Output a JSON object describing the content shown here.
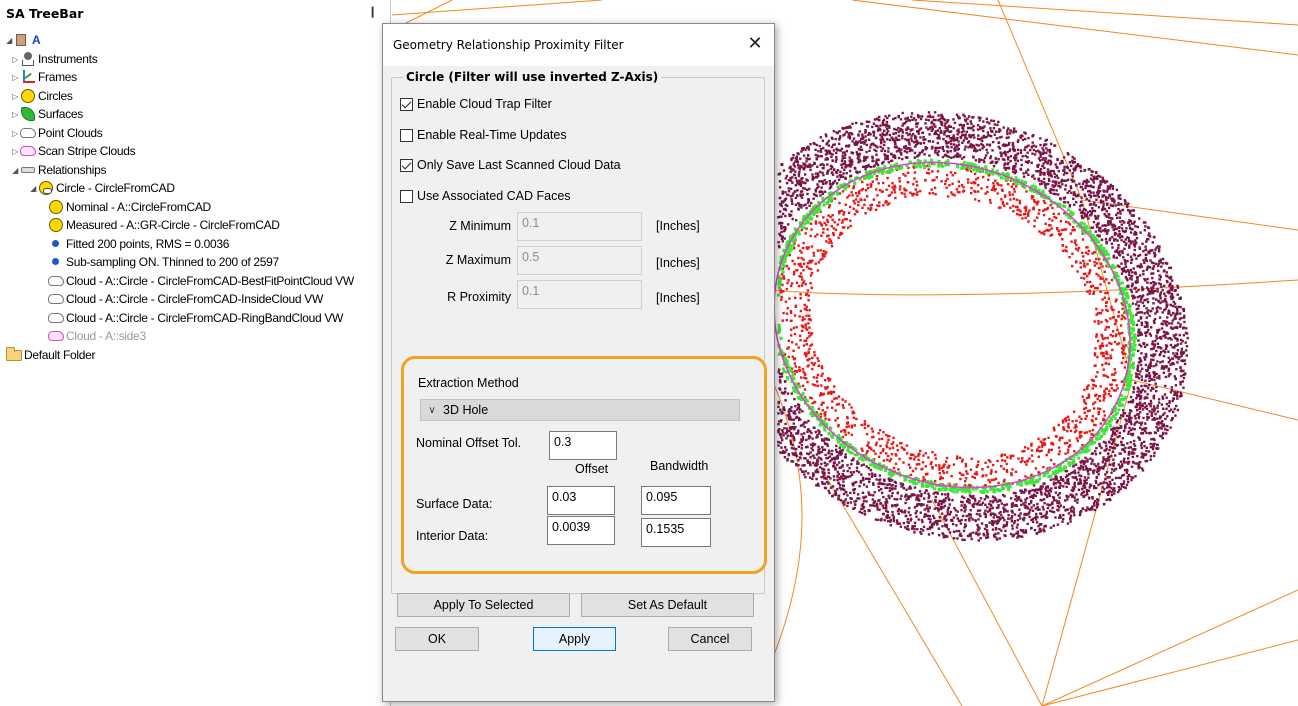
{
  "treebar": {
    "title": "SA TreeBar",
    "pin": "❙",
    "items": [
      {
        "label": "A",
        "icon": "model-icon"
      },
      {
        "label": "Instruments",
        "icon": "instrument-icon"
      },
      {
        "label": "Frames",
        "icon": "frame-icon"
      },
      {
        "label": "Circles",
        "icon": "circle-icon"
      },
      {
        "label": "Surfaces",
        "icon": "surface-icon"
      },
      {
        "label": "Point Clouds",
        "icon": "cloud-icon"
      },
      {
        "label": "Scan Stripe Clouds",
        "icon": "scan-cloud-icon"
      },
      {
        "label": "Relationships",
        "icon": "relationship-icon"
      },
      {
        "label": "Circle - CircleFromCAD",
        "icon": "circle-relationship-icon"
      },
      {
        "label": "Nominal - A::CircleFromCAD",
        "icon": "circle-icon"
      },
      {
        "label": "Measured - A::GR-Circle - CircleFromCAD",
        "icon": "circle-icon"
      },
      {
        "label": "Fitted 200 points, RMS = 0.0036",
        "icon": "info-dot-icon"
      },
      {
        "label": "Sub-sampling ON. Thinned to 200 of 2597",
        "icon": "info-dot-icon"
      },
      {
        "label": "Cloud - A::Circle - CircleFromCAD-BestFitPointCloud VW",
        "icon": "cloud-icon"
      },
      {
        "label": "Cloud - A::Circle - CircleFromCAD-InsideCloud VW",
        "icon": "cloud-icon"
      },
      {
        "label": "Cloud - A::Circle - CircleFromCAD-RingBandCloud VW",
        "icon": "cloud-icon"
      },
      {
        "label": "Cloud - A::side3",
        "icon": "scan-cloud-icon"
      },
      {
        "label": "Default Folder",
        "icon": "folder-icon"
      }
    ]
  },
  "dialog": {
    "title": "Geometry Relationship Proximity Filter",
    "close": "✕",
    "group_title": "Circle (Filter will use inverted Z-Axis)",
    "checks": [
      {
        "label": "Enable Cloud Trap Filter",
        "checked": true
      },
      {
        "label": "Enable Real-Time Updates",
        "checked": false
      },
      {
        "label": "Only Save Last Scanned Cloud Data",
        "checked": true
      },
      {
        "label": "Use Associated CAD Faces",
        "checked": false
      }
    ],
    "z_min": {
      "label": "Z Minimum",
      "value": "0.1",
      "unit": "[Inches]"
    },
    "z_max": {
      "label": "Z Maximum",
      "value": "0.5",
      "unit": "[Inches]"
    },
    "r_prox": {
      "label": "R Proximity",
      "value": "0.1",
      "unit": "[Inches]"
    },
    "extraction": {
      "label": "Extraction Method",
      "selected": "3D Hole",
      "nominal_label": "Nominal Offset  Tol.",
      "nominal_value": "0.3",
      "col_offset": "Offset",
      "col_bandwidth": "Bandwidth",
      "surface_label": "Surface Data:",
      "surface_offset": "0.03",
      "surface_bandwidth": "0.095",
      "interior_label": "Interior Data:",
      "interior_offset": "0.0039",
      "interior_bandwidth": "0.1535"
    },
    "buttons": {
      "apply_selected": "Apply To Selected",
      "set_default": "Set As Default",
      "ok": "OK",
      "apply": "Apply",
      "cancel": "Cancel"
    }
  },
  "colors": {
    "highlight": "#f0a322",
    "outer_cloud": "#7a1446",
    "inner_cloud": "#e8181a",
    "fit_points": "#3ee63a",
    "cad_lines": "#f08a1e"
  }
}
